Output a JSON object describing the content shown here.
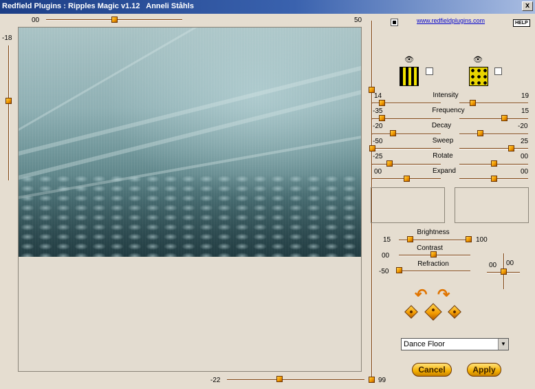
{
  "window": {
    "title": "Redfield Plugins : Ripples Magic v1.12   Anneli Ståhls",
    "close_label": "x"
  },
  "top_slider": {
    "min_label": "00",
    "max_label": "50",
    "value_fraction": 0.5
  },
  "left_slider": {
    "label": "-18",
    "value_fraction": 0.42
  },
  "bottom_slider": {
    "min_label": "-22",
    "max_label": "99",
    "value_fraction": 0.4
  },
  "right_vertical_slider": {
    "value_fraction": 0.12
  },
  "header": {
    "link": "www.redfieldplugins.com",
    "help": "HELP"
  },
  "patterns": {
    "pattern1": {
      "icon": "eye-icon",
      "name": "stripes-pattern-icon",
      "checked": false
    },
    "pattern2": {
      "icon": "eye-icon",
      "name": "checks-pattern-icon",
      "checked": false
    }
  },
  "params": [
    {
      "label": "Intensity",
      "left": "14",
      "right": "19"
    },
    {
      "label": "Frequency",
      "left": "-35",
      "right": "15"
    },
    {
      "label": "Decay",
      "left": "-20",
      "right": "-20"
    },
    {
      "label": "Sweep",
      "left": "-50",
      "right": "25"
    },
    {
      "label": "Rotate",
      "left": "-25",
      "right": "00"
    },
    {
      "label": "Expand",
      "left": "00",
      "right": "00"
    }
  ],
  "colors": {
    "panel_bg": "#e5ddd0",
    "title_bar": "#1c3e86",
    "accent_orange": "#f29a00"
  },
  "adjustments": {
    "brightness": {
      "label": "Brightness",
      "left": "15",
      "right": "100"
    },
    "contrast": {
      "label": "Contrast",
      "value": "00"
    },
    "refraction": {
      "label": "Refraction",
      "value": "-50"
    },
    "xy_pad": {
      "x": "00",
      "y": "00"
    }
  },
  "preset": {
    "selected": "Dance Floor"
  },
  "buttons": {
    "cancel": "Cancel",
    "apply": "Apply"
  }
}
